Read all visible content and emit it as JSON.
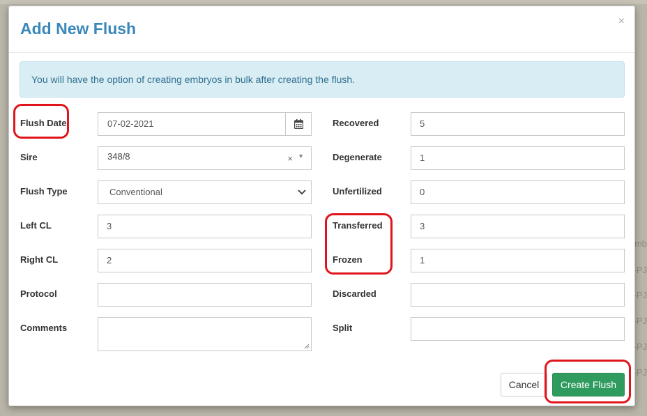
{
  "modal": {
    "title": "Add New Flush",
    "close_glyph": "×",
    "info_message": "You will have the option of creating embryos in bulk after creating the flush."
  },
  "form": {
    "left": {
      "flush_date": {
        "label": "Flush Date",
        "value": "07-02-2021",
        "icon": "calendar-icon"
      },
      "sire": {
        "label": "Sire",
        "value": "348/8",
        "clear_glyph": "×",
        "caret_glyph": "▼"
      },
      "flush_type": {
        "label": "Flush Type",
        "value": "Conventional"
      },
      "left_cl": {
        "label": "Left CL",
        "value": "3"
      },
      "right_cl": {
        "label": "Right CL",
        "value": "2"
      },
      "protocol": {
        "label": "Protocol",
        "value": ""
      },
      "comments": {
        "label": "Comments",
        "value": ""
      }
    },
    "right": {
      "recovered": {
        "label": "Recovered",
        "value": "5"
      },
      "degenerate": {
        "label": "Degenerate",
        "value": "1"
      },
      "unfertilized": {
        "label": "Unfertilized",
        "value": "0"
      },
      "transferred": {
        "label": "Transferred",
        "value": "3"
      },
      "frozen": {
        "label": "Frozen",
        "value": "1"
      },
      "discarded": {
        "label": "Discarded",
        "value": ""
      },
      "split": {
        "label": "Split",
        "value": ""
      }
    }
  },
  "footer": {
    "cancel_label": "Cancel",
    "create_label": "Create Flush"
  },
  "backdrop": {
    "fragments": [
      "mb",
      "-PJ",
      "-PJ",
      "-PJ",
      "-PJ",
      "-PJ"
    ]
  },
  "colors": {
    "title": "#3a88b9",
    "alert_bg": "#d9edf5",
    "alert_text": "#31708f",
    "primary_green": "#2f9b5e",
    "annotation_red": "#e0141b"
  }
}
